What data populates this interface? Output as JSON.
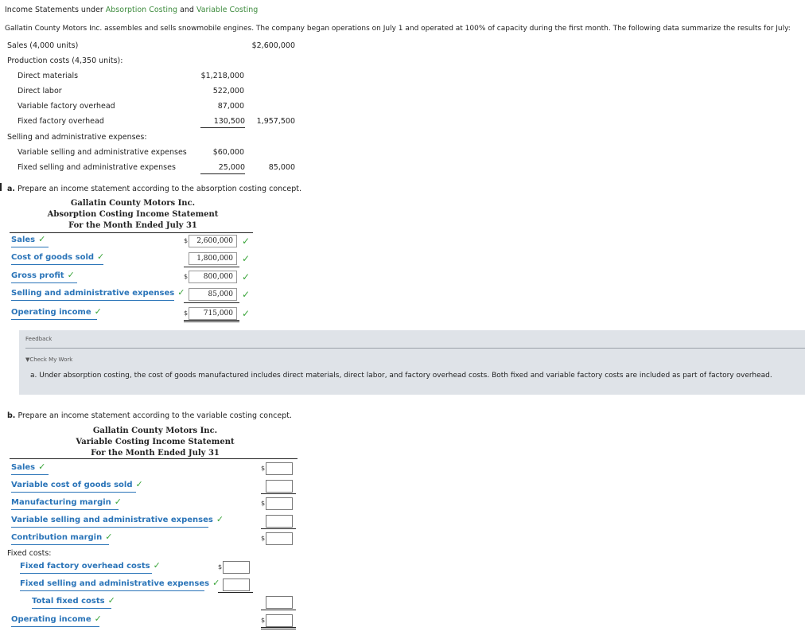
{
  "title": {
    "prefix": "Income Statements under ",
    "link1": "Absorption Costing",
    "and": " and ",
    "link2": "Variable Costing"
  },
  "intro": "Gallatin County Motors Inc. assembles and sells snowmobile engines. The company began operations on July 1 and operated at 100% of capacity during the first month. The following data summarize the results for July:",
  "given": {
    "sales_label": "Sales (4,000 units)",
    "sales_value": "$2,600,000",
    "prod_label": "Production costs (4,350 units):",
    "dm_label": "Direct materials",
    "dm_value": "$1,218,000",
    "dl_label": "Direct labor",
    "dl_value": "522,000",
    "vfo_label": "Variable factory overhead",
    "vfo_value": "87,000",
    "ffo_label": "Fixed factory overhead",
    "ffo_value": "130,500",
    "prod_total": "1,957,500",
    "sga_label": "Selling and administrative expenses:",
    "vsga_label": "Variable selling and administrative expenses",
    "vsga_value": "$60,000",
    "fsga_label": "Fixed selling and administrative expenses",
    "fsga_value": "25,000",
    "sga_total": "85,000"
  },
  "part_a": {
    "letter": "a.",
    "instruction": "Prepare an income statement according to the absorption costing concept.",
    "company": "Gallatin County Motors Inc.",
    "statement": "Absorption Costing Income Statement",
    "period": "For the Month Ended July 31",
    "rows": [
      {
        "label": "Sales",
        "value": "2,600,000",
        "dollar": "$"
      },
      {
        "label": "Cost of goods sold",
        "value": "1,800,000",
        "dollar": ""
      },
      {
        "label": "Gross profit",
        "value": "800,000",
        "dollar": "$"
      },
      {
        "label": "Selling and administrative expenses",
        "value": "85,000",
        "dollar": ""
      },
      {
        "label": "Operating income",
        "value": "715,000",
        "dollar": "$"
      }
    ]
  },
  "feedback": {
    "label": "Feedback",
    "toggle": "Check My Work",
    "text": "a. Under absorption costing, the cost of goods manufactured includes direct materials, direct labor, and factory overhead costs. Both fixed and variable factory costs are included as part of factory overhead."
  },
  "part_b": {
    "letter": "b.",
    "instruction": "Prepare an income statement according to the variable costing concept.",
    "company": "Gallatin County Motors Inc.",
    "statement": "Variable Costing Income Statement",
    "period": "For the Month Ended July 31",
    "rows": {
      "sales": "Sales",
      "vcogs": "Variable cost of goods sold",
      "mfg_margin": "Manufacturing margin",
      "vsga": "Variable selling and administrative expenses",
      "contrib": "Contribution margin",
      "fixed_costs": "Fixed costs:",
      "ffo": "Fixed factory overhead costs",
      "fsga": "Fixed selling and administrative expenses",
      "total_fixed": "Total fixed costs",
      "op_income": "Operating income"
    }
  },
  "symbols": {
    "check": "✓",
    "dollar": "$",
    "triangle": "▼"
  },
  "colors": {
    "link_green": "#3d8b3d",
    "select_blue": "#2a74b8",
    "check_green": "#3aa53a",
    "feedback_bg": "#dfe3e8"
  }
}
